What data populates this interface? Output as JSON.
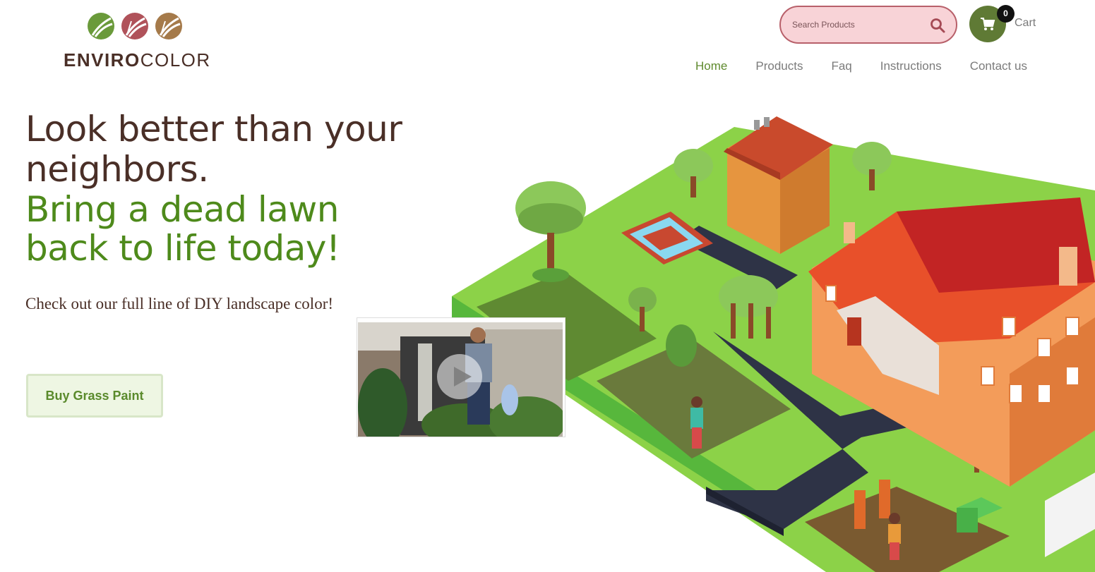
{
  "brand": {
    "name_bold": "ENVIRO",
    "name_light": "COLOR"
  },
  "search": {
    "placeholder": "Search Products"
  },
  "cart": {
    "count": "0",
    "label": "Cart"
  },
  "nav": {
    "items": [
      {
        "label": "Home",
        "active": true
      },
      {
        "label": "Products",
        "active": false
      },
      {
        "label": "Faq",
        "active": false
      },
      {
        "label": "Instructions",
        "active": false
      },
      {
        "label": "Contact us",
        "active": false
      }
    ]
  },
  "hero": {
    "headline": "Look better than your neighbors.",
    "headline_green": "Bring a dead lawn back to life today!",
    "subtext": "Check out our full line of DIY landscape color!",
    "cta_label": "Buy Grass Paint"
  },
  "colors": {
    "brown": "#4a2f27",
    "green": "#4e8a1b",
    "cart_green": "#5f7a35",
    "search_bg": "#f8d3d7",
    "search_border": "#b8606a",
    "nav_active": "#5f8a2e"
  },
  "icons": {
    "search": "search-icon",
    "cart": "cart-icon",
    "play": "play-icon"
  }
}
